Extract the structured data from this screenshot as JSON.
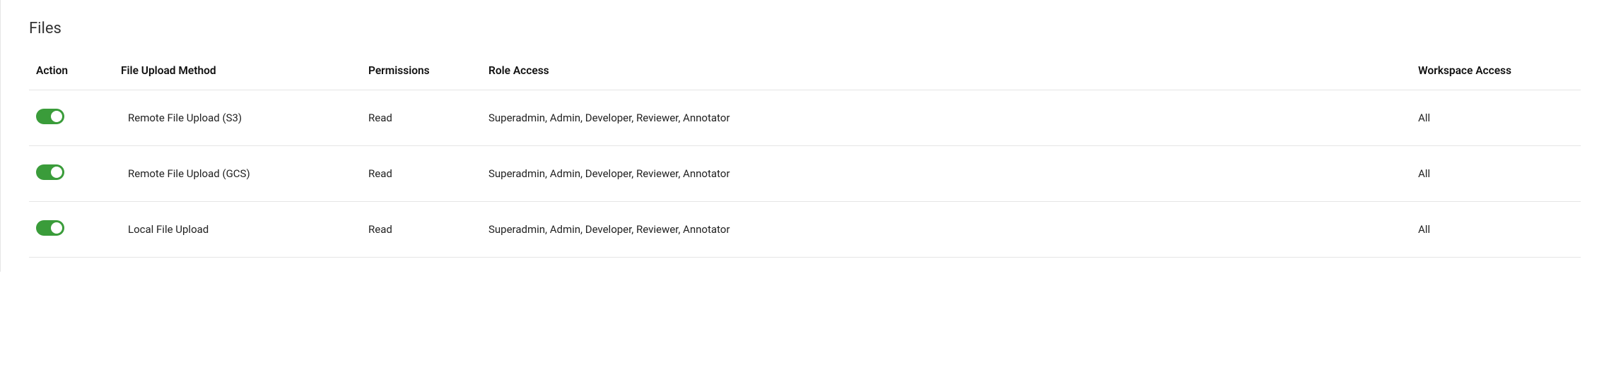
{
  "section": {
    "title": "Files"
  },
  "table": {
    "headers": {
      "action": "Action",
      "method": "File Upload Method",
      "permissions": "Permissions",
      "role_access": "Role Access",
      "workspace_access": "Workspace Access"
    },
    "rows": [
      {
        "enabled": true,
        "method": "Remote File Upload (S3)",
        "permissions": "Read",
        "role_access": "Superadmin, Admin, Developer, Reviewer, Annotator",
        "workspace_access": "All"
      },
      {
        "enabled": true,
        "method": "Remote File Upload (GCS)",
        "permissions": "Read",
        "role_access": "Superadmin, Admin, Developer, Reviewer, Annotator",
        "workspace_access": "All"
      },
      {
        "enabled": true,
        "method": "Local File Upload",
        "permissions": "Read",
        "role_access": "Superadmin, Admin, Developer, Reviewer, Annotator",
        "workspace_access": "All"
      }
    ]
  },
  "colors": {
    "toggle_on": "#3a9c3a",
    "border": "#e5e5e5"
  }
}
